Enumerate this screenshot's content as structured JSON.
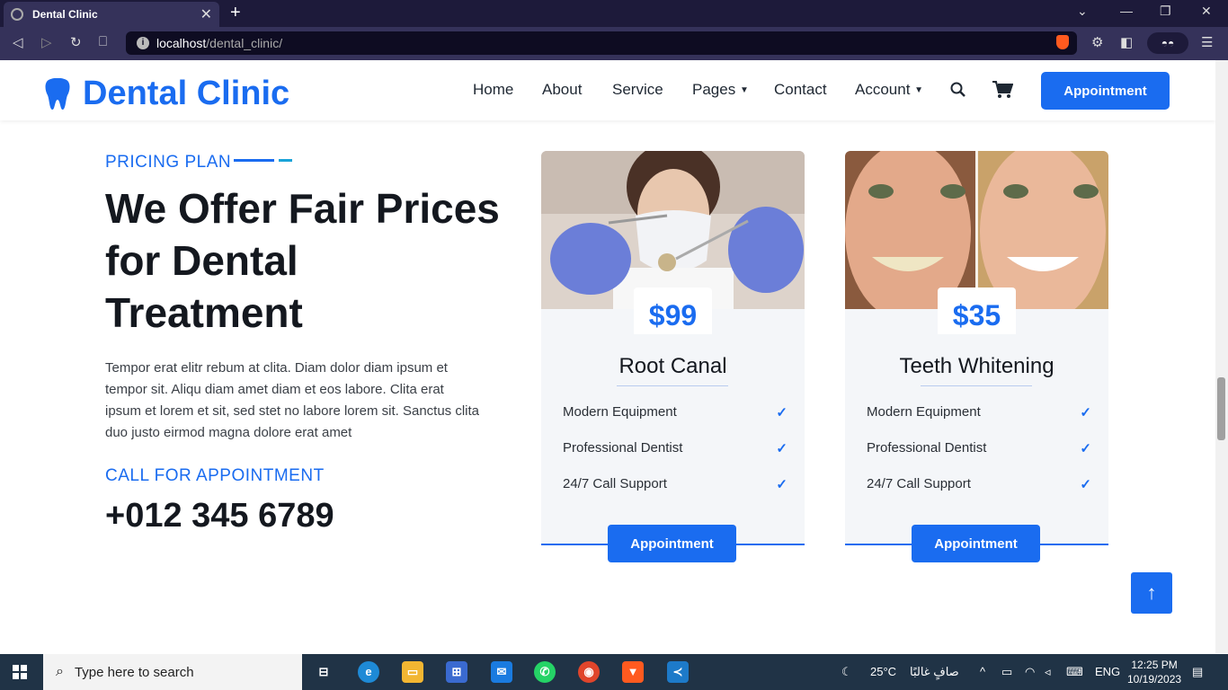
{
  "browser": {
    "tab_title": "Dental Clinic",
    "tab_close": "✕",
    "new_tab": "+",
    "url_host": "localhost",
    "url_path": "/dental_clinic/"
  },
  "site": {
    "brand": "Dental Clinic",
    "nav": {
      "home": "Home",
      "about": "About",
      "service": "Service",
      "pages": "Pages",
      "contact": "Contact",
      "account": "Account"
    },
    "header_button": "Appointment"
  },
  "pricing": {
    "eyebrow": "PRICING PLAN",
    "headline": "We Offer Fair Prices for Dental Treatment",
    "paragraph": "Tempor erat elitr rebum at clita. Diam dolor diam ipsum et tempor sit. Aliqu diam amet diam et eos labore. Clita erat ipsum et lorem et sit, sed stet no labore lorem sit. Sanctus clita duo justo eirmod magna dolore erat amet",
    "call_label": "CALL FOR APPOINTMENT",
    "phone": "+012 345 6789"
  },
  "cards": [
    {
      "price": "$99",
      "service": "Root Canal",
      "features": [
        "Modern Equipment",
        "Professional Dentist",
        "24/7 Call Support"
      ],
      "button": "Appointment"
    },
    {
      "price": "$35",
      "service": "Teeth Whitening",
      "features": [
        "Modern Equipment",
        "Professional Dentist",
        "24/7 Call Support"
      ],
      "button": "Appointment"
    }
  ],
  "taskbar": {
    "search_placeholder": "Type here to search",
    "weather_temp": "25°C",
    "weather_text": "صافٍ غالبًا",
    "language": "ENG",
    "time": "12:25 PM",
    "date": "10/19/2023"
  },
  "colors": {
    "brand_blue": "#1a6cf0",
    "browser_dark": "#1d1a3a",
    "taskbar": "#203346"
  }
}
